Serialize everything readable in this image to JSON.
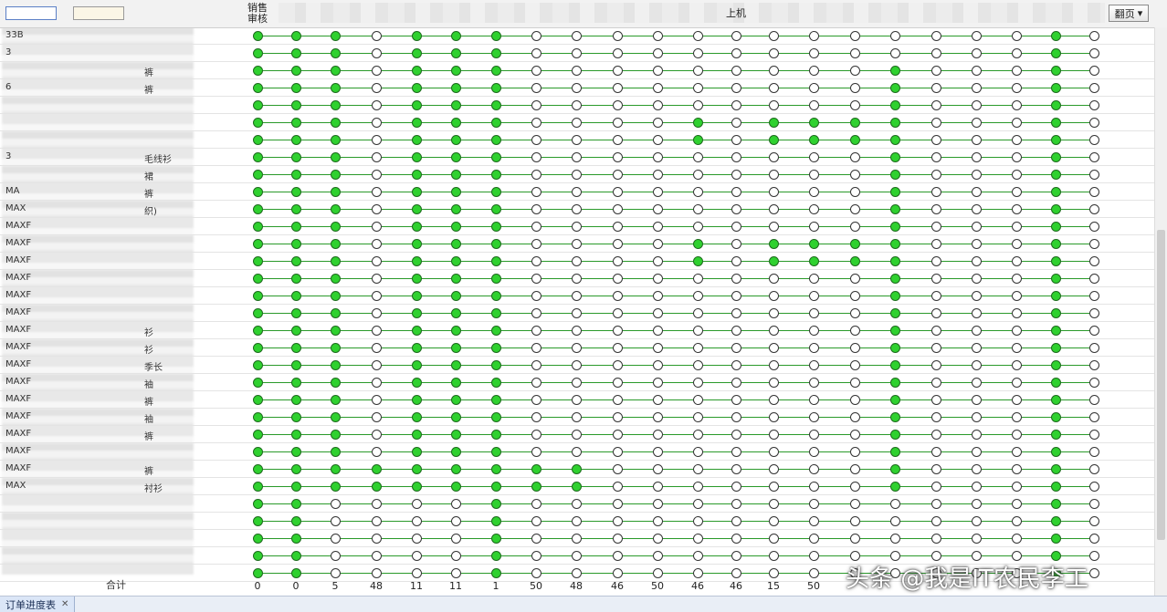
{
  "toolbar": {
    "page_button_label": "翻页",
    "page_button_icon": "caret-down-icon"
  },
  "columns": [
    {
      "label": "销售\n审核"
    },
    {
      "label": ""
    },
    {
      "label": ""
    },
    {
      "label": ""
    },
    {
      "label": ""
    },
    {
      "label": ""
    },
    {
      "label": ""
    },
    {
      "label": ""
    },
    {
      "label": ""
    },
    {
      "label": ""
    },
    {
      "label": ""
    },
    {
      "label": ""
    },
    {
      "label": "上机"
    },
    {
      "label": ""
    },
    {
      "label": ""
    },
    {
      "label": ""
    },
    {
      "label": ""
    },
    {
      "label": ""
    },
    {
      "label": ""
    },
    {
      "label": ""
    },
    {
      "label": ""
    },
    {
      "label": ""
    }
  ],
  "rows": [
    {
      "code": "33B",
      "name": "",
      "states": "1110111000000000000010"
    },
    {
      "code": "3",
      "name": "",
      "states": "1110111000000000000010"
    },
    {
      "code": "",
      "name": "裤",
      "states": "1110111000000000100010"
    },
    {
      "code": "6",
      "name": "裤",
      "states": "1110111000000000100010"
    },
    {
      "code": "",
      "name": "",
      "states": "1110111000000000100010"
    },
    {
      "code": "",
      "name": "",
      "states": "1110111000010111100010"
    },
    {
      "code": "",
      "name": "",
      "states": "1110111000010111100010"
    },
    {
      "code": "3",
      "name": "毛线衫",
      "states": "1110111000000000100010"
    },
    {
      "code": "",
      "name": "裙",
      "states": "1110111000000000100010"
    },
    {
      "code": "MA",
      "name": "裤",
      "states": "1110111000000000100010"
    },
    {
      "code": "MAX",
      "name": "织)",
      "states": "1110111000000000100010"
    },
    {
      "code": "MAXF",
      "name": "",
      "states": "1110111000000000100010"
    },
    {
      "code": "MAXF",
      "name": "",
      "states": "1110111000010111100010"
    },
    {
      "code": "MAXF",
      "name": "",
      "states": "1110111000010111100010"
    },
    {
      "code": "MAXF",
      "name": "",
      "states": "1110111000000000100010"
    },
    {
      "code": "MAXF",
      "name": "",
      "states": "1110111000000000100010"
    },
    {
      "code": "MAXF",
      "name": "",
      "states": "1110111000000000100010"
    },
    {
      "code": "MAXF",
      "name": "衫",
      "states": "1110111000000000100010"
    },
    {
      "code": "MAXF",
      "name": "衫",
      "states": "1110111000000000100010"
    },
    {
      "code": "MAXF",
      "name": "季长",
      "states": "1110111000000000100010"
    },
    {
      "code": "MAXF",
      "name": "袖",
      "states": "1110111000000000100010"
    },
    {
      "code": "MAXF",
      "name": "裤",
      "states": "1110111000000000100010"
    },
    {
      "code": "MAXF",
      "name": "袖",
      "states": "1110111000000000100010"
    },
    {
      "code": "MAXF",
      "name": "裤",
      "states": "1110111000000000100010"
    },
    {
      "code": "MAXF",
      "name": "",
      "states": "1110111000000000100010"
    },
    {
      "code": "MAXF",
      "name": "裤",
      "states": "1111111110000000100010"
    },
    {
      "code": "MAX",
      "name": "衬衫",
      "states": "1111111110000000100010"
    },
    {
      "code": "",
      "name": "",
      "states": "1100001000000000000010"
    },
    {
      "code": "",
      "name": "",
      "states": "1100001000000000000010"
    },
    {
      "code": "",
      "name": "",
      "states": "1100001000000000000010"
    },
    {
      "code": "",
      "name": "",
      "states": "1100001000000000000010"
    },
    {
      "code": "",
      "name": "",
      "states": "1100001000000000000010"
    }
  ],
  "totals": {
    "label": "合计",
    "values": [
      "0",
      "0",
      "5",
      "48",
      "11",
      "11",
      "1",
      "50",
      "48",
      "46",
      "50",
      "46",
      "46",
      "15",
      "50",
      "",
      "",
      "",
      "",
      "",
      "",
      ""
    ]
  },
  "status": {
    "tab_label": "订单进度表",
    "close_icon": "close-icon"
  },
  "watermark": "头条 @我是IT农民李工"
}
